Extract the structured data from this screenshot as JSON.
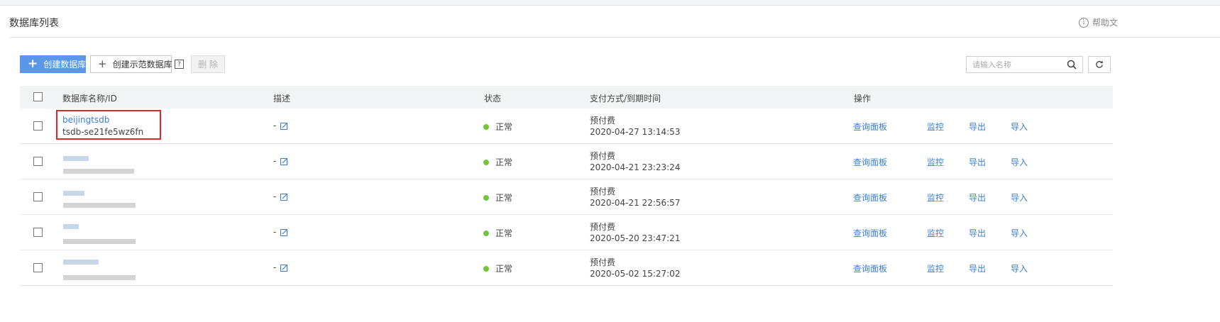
{
  "page": {
    "title": "数据库列表",
    "help": "帮助文"
  },
  "toolbar": {
    "create_label": "创建数据库",
    "create_demo_label": "创建示范数据库",
    "help_mark": "?",
    "delete_label": "删 除"
  },
  "search": {
    "placeholder": "请输入名称"
  },
  "table": {
    "columns": [
      "数据库名称/ID",
      "描述",
      "状态",
      "支付方式/到期时间",
      "操作"
    ],
    "actions": [
      "查询面板",
      "监控",
      "导出",
      "导入"
    ],
    "rows": [
      {
        "name": "beijingtsdb",
        "id": "tsdb-se21fe5wz6fn",
        "desc": "-",
        "status": "正常",
        "pay": "预付费",
        "expire": "2020-04-27 13:14:53",
        "blurred": false
      },
      {
        "name": "",
        "id": "",
        "desc": "-",
        "status": "正常",
        "pay": "预付费",
        "expire": "2020-04-21 23:23:24",
        "blurred": true
      },
      {
        "name": "",
        "id": "",
        "desc": "-",
        "status": "正常",
        "pay": "预付费",
        "expire": "2020-04-21 22:56:57",
        "blurred": true
      },
      {
        "name": "",
        "id": "",
        "desc": "-",
        "status": "正常",
        "pay": "预付费",
        "expire": "2020-05-20 23:47:21",
        "blurred": true
      },
      {
        "name": "",
        "id": "",
        "desc": "-",
        "status": "正常",
        "pay": "预付费",
        "expire": "2020-05-02 15:27:02",
        "blurred": true
      }
    ]
  },
  "colors": {
    "primary": "#5a97e8",
    "link": "#3a7fd4",
    "status_ok": "#75c53a",
    "highlight": "#d9292b"
  }
}
